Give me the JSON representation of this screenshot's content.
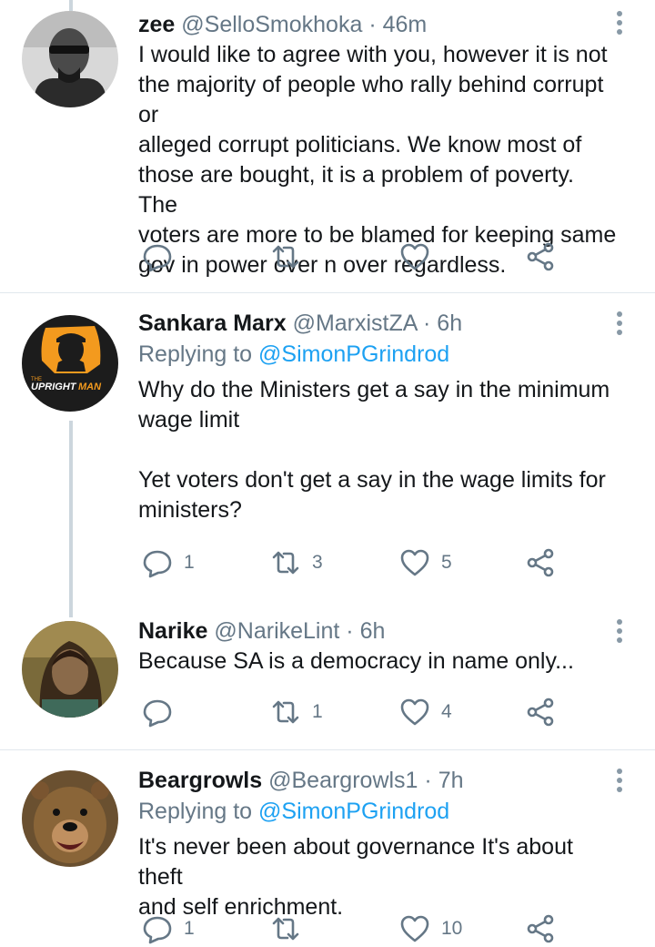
{
  "tweets": [
    {
      "name": "zee",
      "handle": "@SelloSmokhoka",
      "dot": "·",
      "time": "46m",
      "reply_prefix": "",
      "reply_mention": "",
      "lines": [
        "I would like to agree with you, however it is not",
        "the majority of people who rally behind corrupt or",
        "alleged corrupt politicians. We know most of",
        "those are bought, it is a problem of poverty. The",
        "voters are more to be blamed for keeping same",
        "gov in power over n over regardless."
      ],
      "replies": "",
      "retweets": "",
      "likes": ""
    },
    {
      "name": "Sankara Marx",
      "handle": "@MarxistZA",
      "dot": "·",
      "time": "6h",
      "reply_prefix": "Replying to",
      "reply_mention": "@SimonPGrindrod",
      "lines": [
        "Why do the Ministers get a say in the minimum",
        "wage limit",
        "Yet voters don't get a say in the wage limits for",
        "ministers?"
      ],
      "replies": "1",
      "retweets": "3",
      "likes": "5",
      "avatar_text": [
        "THE",
        "UPRIGHT",
        "MAN"
      ]
    },
    {
      "name": "Narike",
      "handle": "@NarikeLint",
      "dot": "·",
      "time": "6h",
      "reply_prefix": "",
      "reply_mention": "",
      "lines": [
        "Because SA is a democracy in name only..."
      ],
      "replies": "",
      "retweets": "1",
      "likes": "4"
    },
    {
      "name": "Beargrowls",
      "handle": "@Beargrowls1",
      "dot": "·",
      "time": "7h",
      "reply_prefix": "Replying to",
      "reply_mention": "@SimonPGrindrod",
      "lines": [
        "It's never been about governance It's about theft",
        "and self enrichment."
      ],
      "replies": "1",
      "retweets": "",
      "likes": "10"
    }
  ],
  "colors": {
    "text": "#14171a",
    "secondary": "#657786",
    "link": "#1da1f2",
    "divider": "#e1e8ed",
    "icon": "#657786",
    "brand_orange": "#f39a1e"
  }
}
